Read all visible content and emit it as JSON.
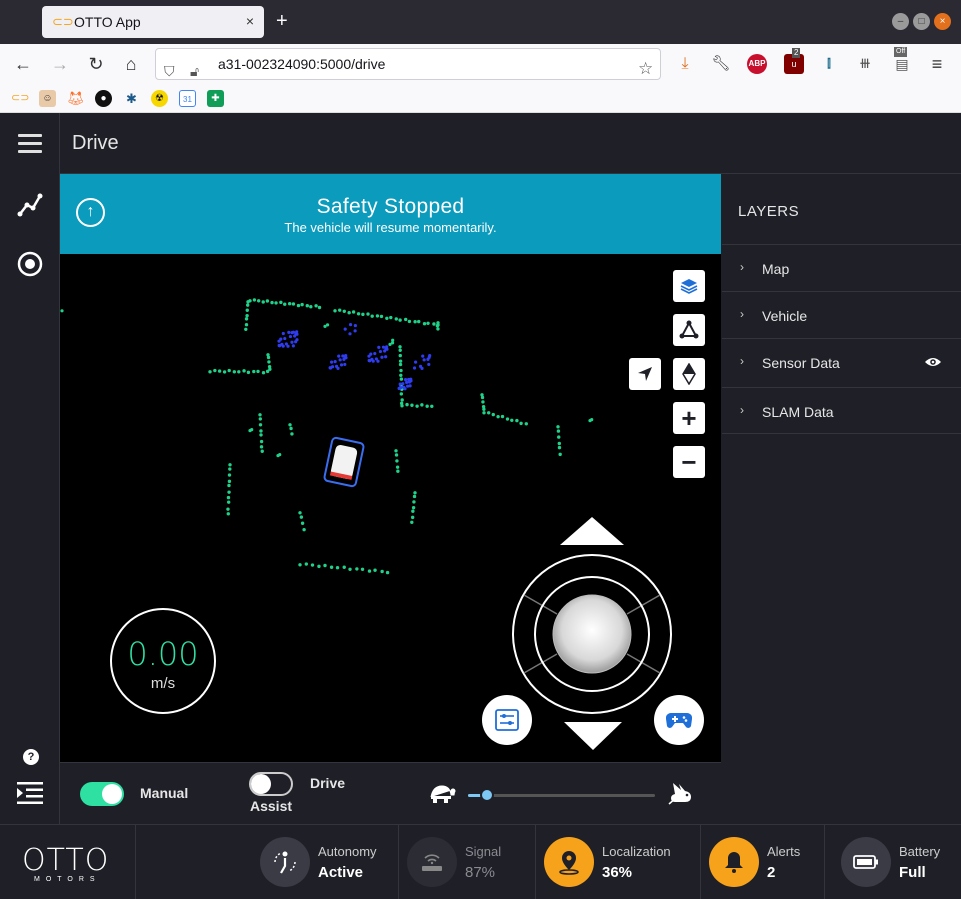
{
  "browser": {
    "tab_title": "OTTO App",
    "tab_close": "×",
    "new_tab": "+",
    "url": "a31-002324090:5000/drive",
    "ext_badge_count": "2",
    "ext_off_badge": "Off",
    "bookmark_calendar": "31"
  },
  "app": {
    "page_title": "Drive",
    "banner": {
      "title": "Safety Stopped",
      "subtitle": "The vehicle will resume momentarily."
    },
    "speed": {
      "value": "0.00",
      "unit": "m/s"
    },
    "layers": {
      "title": "LAYERS",
      "items": [
        {
          "label": "Map"
        },
        {
          "label": "Vehicle"
        },
        {
          "label": "Sensor Data"
        },
        {
          "label": "SLAM Data"
        }
      ]
    },
    "controls": {
      "manual_label": "Manual",
      "manual_on": true,
      "drive_assist_label_1": "Drive",
      "drive_assist_label_2": "Assist",
      "drive_assist_on": false,
      "speed_slider_level": 0.1
    },
    "help_glyph": "?",
    "logo": {
      "main": "OTTO",
      "sub": "MOTORS"
    },
    "status": {
      "autonomy": {
        "label": "Autonomy",
        "value": "Active"
      },
      "signal": {
        "label": "Signal",
        "value": "87%"
      },
      "localization": {
        "label": "Localization",
        "value": "36%"
      },
      "alerts": {
        "label": "Alerts",
        "value": "2"
      },
      "battery": {
        "label": "Battery",
        "value": "Full"
      }
    },
    "colors": {
      "accent_teal": "#0b9bbc",
      "speed_green": "#2ee0a2",
      "toggle_green": "#2ee0a2",
      "warning_orange": "#f7a21b",
      "lidar_green": "#1ed28a",
      "lidar_blue": "#2f3cf0"
    }
  }
}
